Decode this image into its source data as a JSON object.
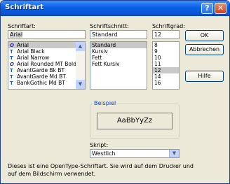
{
  "window": {
    "title": "Schriftart"
  },
  "font": {
    "label": "Schriftart:",
    "value": "Arial",
    "items": [
      {
        "name": "Arial",
        "icon": "opentype-icon",
        "glyph": "O",
        "selected": true
      },
      {
        "name": "Arial Black",
        "icon": "truetype-icon",
        "glyph": "T"
      },
      {
        "name": "Arial Narrow",
        "icon": "truetype-icon",
        "glyph": "T"
      },
      {
        "name": "Arial Rounded MT Bold",
        "icon": "opentype-icon",
        "glyph": "O"
      },
      {
        "name": "AvantGarde Bk BT",
        "icon": "truetype-icon",
        "glyph": "T"
      },
      {
        "name": "AvantGarde Md BT",
        "icon": "truetype-icon",
        "glyph": "T"
      },
      {
        "name": "BankGothic Md BT",
        "icon": "truetype-icon",
        "glyph": "T"
      }
    ]
  },
  "style": {
    "label": "Schriftschnitt:",
    "value": "Standard",
    "items": [
      "Standard",
      "Kursiv",
      "Fett",
      "Fett Kursiv"
    ],
    "selected_index": 0
  },
  "size": {
    "label": "Schriftgrad:",
    "value": "12",
    "items": [
      "8",
      "9",
      "10",
      "11",
      "12",
      "14",
      "16"
    ],
    "selected_index": 4
  },
  "buttons": {
    "ok": "OK",
    "cancel": "Abbrechen",
    "help": "Hilfe"
  },
  "sample": {
    "group_label": "Beispiel",
    "text": "AaBbYyZz"
  },
  "script": {
    "label": "Skript:",
    "value": "Westlich"
  },
  "description": {
    "line1": "Dieses ist eine OpenType-Schriftart. Sie wird auf dem Drucker und",
    "line2": "auf dem Bildschirm verwendet."
  },
  "titlebar_buttons": {
    "help": "?",
    "close": "✕"
  },
  "scroll_arrows": {
    "up": "▲",
    "down": "▼"
  }
}
